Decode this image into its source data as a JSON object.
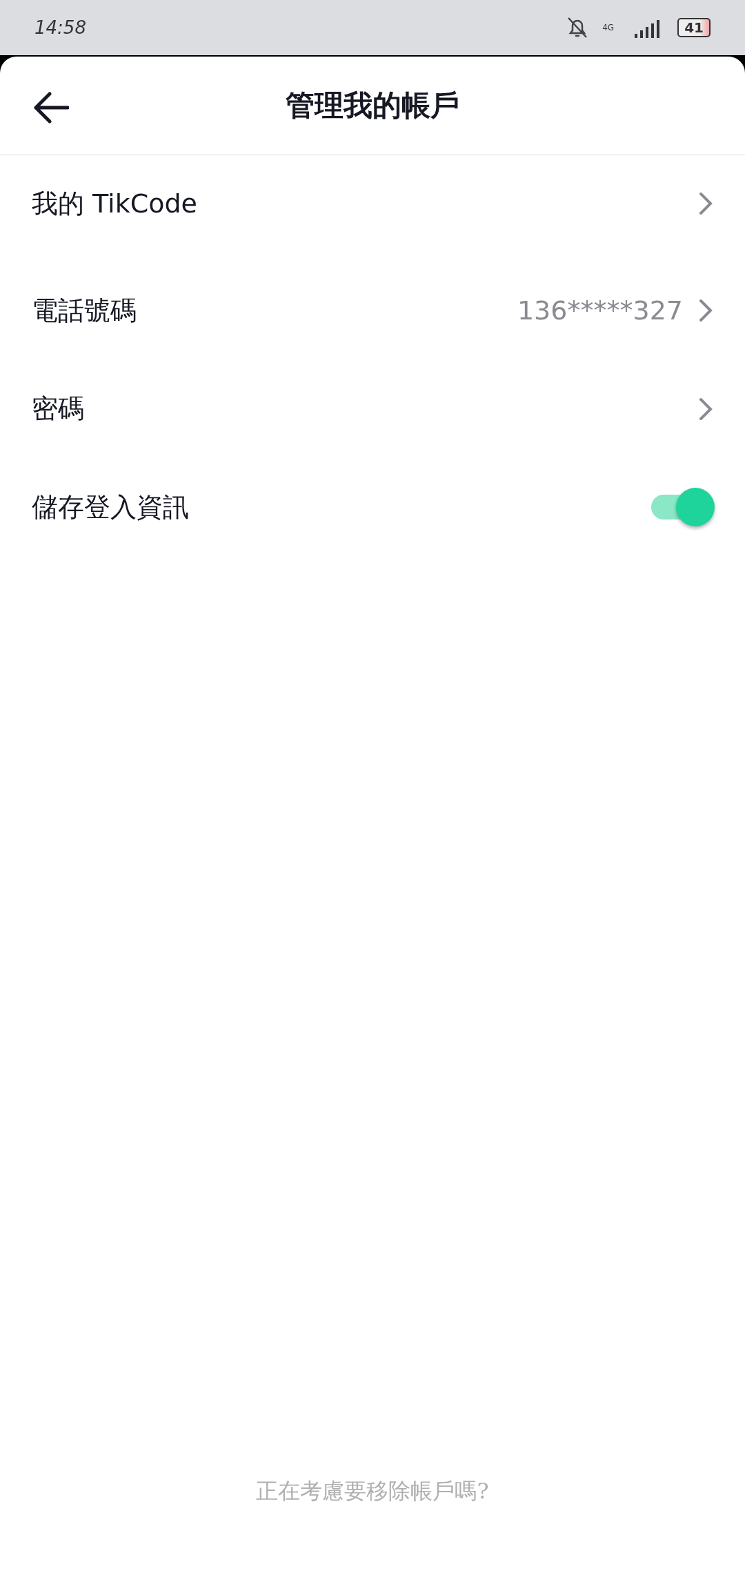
{
  "status_bar": {
    "time": "14:58",
    "network": "4G",
    "battery": "41"
  },
  "header": {
    "title": "管理我的帳戶"
  },
  "rows": [
    {
      "kind": "link",
      "label": "我的 TikCode"
    },
    {
      "kind": "link",
      "label": "電話號碼",
      "value": "136*****327"
    },
    {
      "kind": "link",
      "label": "密碼"
    },
    {
      "kind": "toggle",
      "label": "儲存登入資訊",
      "on": true
    }
  ],
  "footer": {
    "link": "正在考慮要移除帳戶嗎?"
  }
}
